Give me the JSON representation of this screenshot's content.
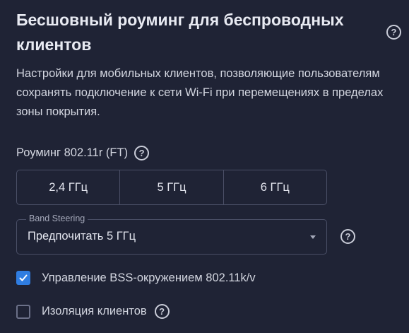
{
  "section": {
    "title": "Бесшовный роуминг для беспроводных клиентов",
    "description": "Настройки для мобильных клиентов, позволяющие пользователям сохранять подключение к сети Wi-Fi при перемещениях в пределах зоны покрытия."
  },
  "roaming": {
    "label": "Роуминг 802.11r (FT)",
    "bands": [
      "2,4 ГГц",
      "5 ГГц",
      "6 ГГц"
    ]
  },
  "band_steering": {
    "label": "Band Steering",
    "value": "Предпочитать 5 ГГц"
  },
  "bss": {
    "label": "Управление BSS-окружением 802.11k/v",
    "checked": true
  },
  "isolation": {
    "label": "Изоляция клиентов",
    "checked": false
  },
  "icons": {
    "help": "?"
  },
  "colors": {
    "background": "#1f2335",
    "accent": "#2f7de1",
    "border": "#4a4f66"
  }
}
